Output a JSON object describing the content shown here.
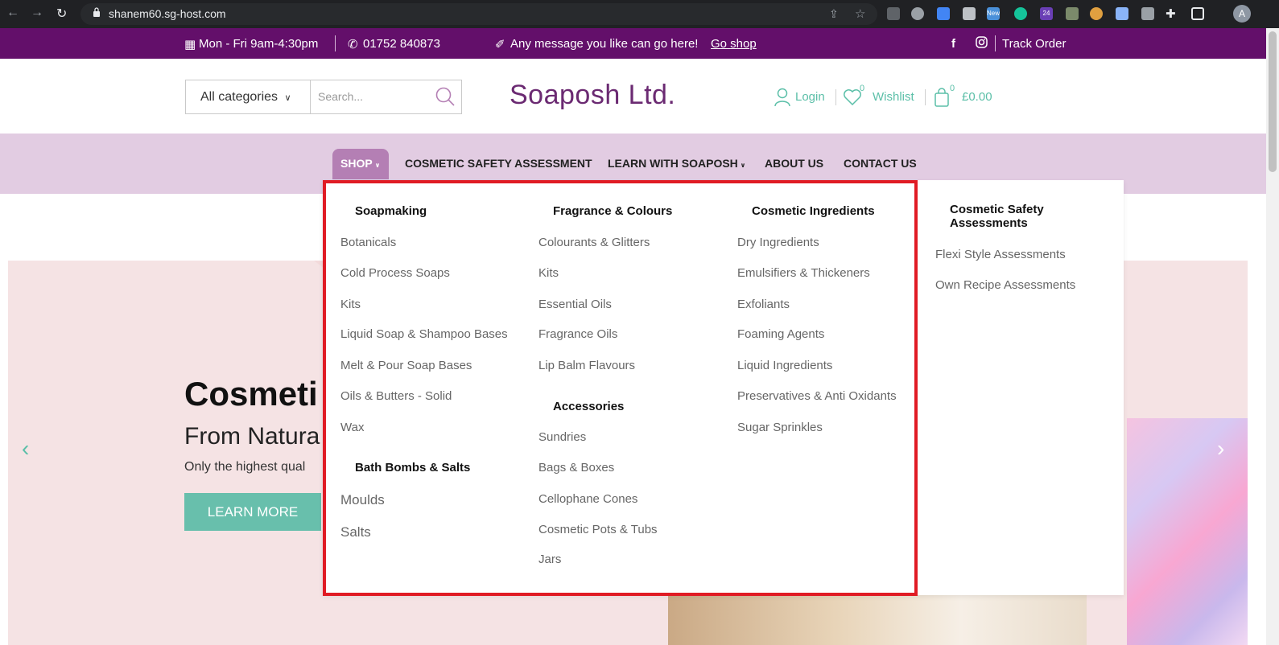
{
  "browser": {
    "url": "shanem60.sg-host.com",
    "avatar_letter": "A",
    "ext_badge_new": "New",
    "ext_badge_24": "24"
  },
  "topbar": {
    "hours": "Mon - Fri 9am-4:30pm",
    "phone": "01752 840873",
    "message": "Any message you like can go here!",
    "message_link": "Go shop",
    "track_order": "Track Order"
  },
  "header": {
    "category_select": "All categories",
    "search_placeholder": "Search...",
    "logo": "Soaposh Ltd.",
    "login": "Login",
    "wishlist": "Wishlist",
    "wishlist_count": "0",
    "cart_count": "0",
    "cart_total": "£0.00"
  },
  "nav": {
    "shop": "SHOP",
    "csa": "COSMETIC SAFETY ASSESSMENT",
    "learn": "LEARN WITH SOAPOSH",
    "about": "ABOUT US",
    "contact": "CONTACT US"
  },
  "mega_menu": {
    "soapmaking": {
      "title": "Soapmaking",
      "items": [
        "Botanicals",
        "Cold Process Soaps",
        "Kits",
        "Liquid Soap & Shampoo Bases",
        "Melt & Pour Soap Bases",
        "Oils & Butters - Solid",
        "Wax"
      ]
    },
    "bath": {
      "title": "Bath Bombs & Salts",
      "items": [
        "Moulds",
        "Salts"
      ]
    },
    "fragrance": {
      "title": "Fragrance & Colours",
      "items": [
        "Colourants & Glitters",
        "Kits",
        "Essential Oils",
        "Fragrance Oils",
        "Lip Balm Flavours"
      ]
    },
    "accessories": {
      "title": "Accessories",
      "items": [
        "Sundries",
        "Bags & Boxes",
        "Cellophane Cones",
        "Cosmetic Pots & Tubs",
        "Jars"
      ]
    },
    "ingredients": {
      "title": "Cosmetic Ingredients",
      "items": [
        "Dry Ingredients",
        "Emulsifiers & Thickeners",
        "Exfoliants",
        "Foaming Agents",
        "Liquid Ingredients",
        "Preservatives & Anti Oxidants",
        "Sugar Sprinkles"
      ]
    },
    "safety": {
      "title_line1": "Cosmetic Safety",
      "title_line2": "Assessments",
      "items": [
        "Flexi Style Assessments",
        "Own Recipe Assessments"
      ]
    }
  },
  "hero": {
    "title": "Cosmeti",
    "subtitle": "From Natura",
    "text": "Only the highest qual",
    "button": "LEARN MORE"
  },
  "colors": {
    "topbar": "#630f6a",
    "accent_teal": "#5bbfa8",
    "nav_band": "#e2cce2",
    "shop_active": "#b47fb4",
    "highlight_red": "#e01b24"
  }
}
